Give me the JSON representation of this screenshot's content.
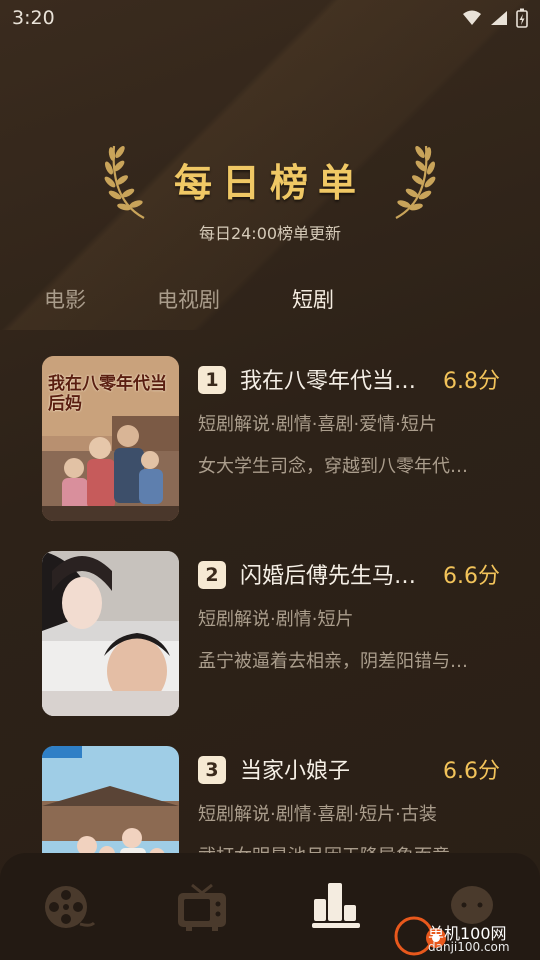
{
  "status_bar": {
    "time": "3:20"
  },
  "header": {
    "title": "每日榜单",
    "subtitle": "每日24:00榜单更新"
  },
  "tabs": [
    {
      "label": "电影",
      "active": false
    },
    {
      "label": "电视剧",
      "active": false
    },
    {
      "label": "短剧",
      "active": true
    }
  ],
  "items": [
    {
      "rank": "1",
      "title": "我在八零年代当…",
      "score": "6.8分",
      "tags": "短剧解说·剧情·喜剧·爱情·短片",
      "description": "女大学生司念，穿越到八零年代…",
      "poster_text": "我在八零年代当后妈"
    },
    {
      "rank": "2",
      "title": "闪婚后傅先生马…",
      "score": "6.6分",
      "tags": "短剧解说·剧情·短片",
      "description": "孟宁被逼着去相亲，阴差阳错与…"
    },
    {
      "rank": "3",
      "title": "当家小娘子",
      "score": "6.6分",
      "tags": "短剧解说·剧情·喜剧·短片·古装",
      "description": "武打女明星池月因天降异象而意…"
    }
  ],
  "bottom_nav": [
    {
      "icon": "film-reel-icon",
      "active": false
    },
    {
      "icon": "tv-icon",
      "active": false
    },
    {
      "icon": "ranking-icon",
      "active": true
    },
    {
      "icon": "chat-bubble-icon",
      "active": false
    }
  ],
  "watermark": {
    "text": "单机100网",
    "sub": "danji100.com"
  },
  "colors": {
    "accent": "#f2c35a",
    "background": "#2a2018",
    "bar": "#231a13"
  }
}
